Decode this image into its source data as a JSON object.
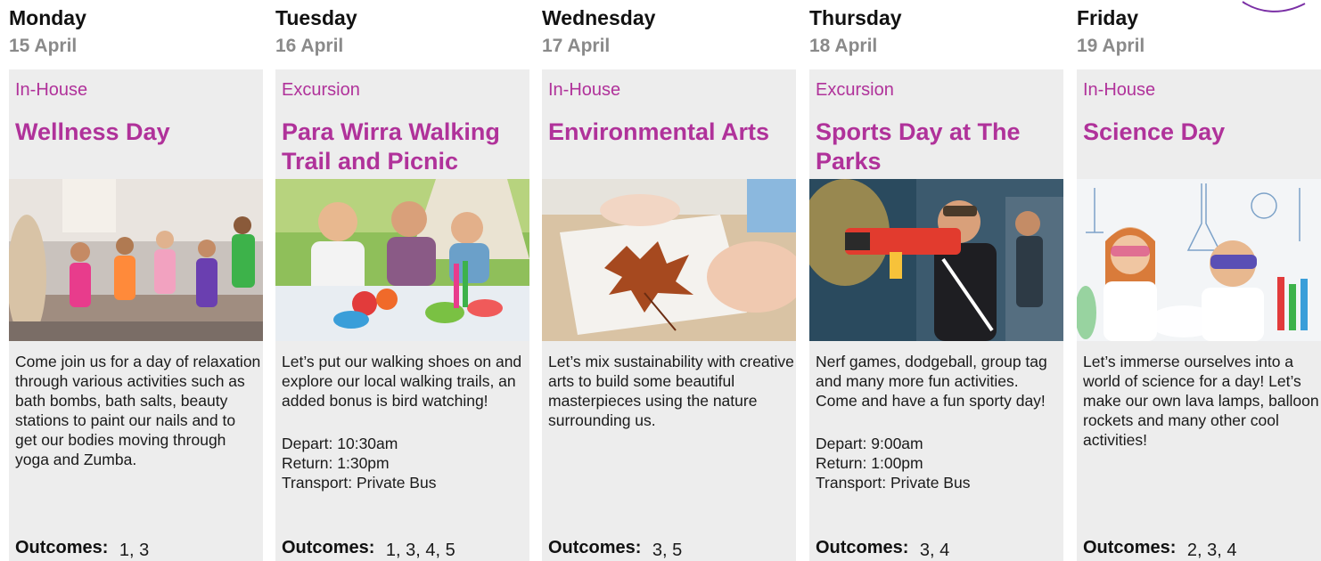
{
  "days": [
    {
      "day": "Monday",
      "date": "15 April",
      "type": "In-House",
      "title": "Wellness Day",
      "image_icon": "wellness-dance-photo",
      "description": "Come join us for a day of relaxation through various activities such as bath bombs, bath salts, beauty stations to paint our nails and to get our bodies moving through yoga and Zumba.",
      "depart": "",
      "return": "",
      "transport": "",
      "outcomes_label": "Outcomes:",
      "outcomes": "1, 3"
    },
    {
      "day": "Tuesday",
      "date": "16 April",
      "type": "Excursion",
      "title": "Para Wirra Walking Trail and Picnic",
      "image_icon": "picnic-photo",
      "description": "Let’s put our walking shoes on and explore our local walking trails, an added bonus is bird watching!",
      "depart": "Depart: 10:30am",
      "return": "Return: 1:30pm",
      "transport": "Transport: Private Bus",
      "outcomes_label": "Outcomes:",
      "outcomes": "1, 3, 4, 5"
    },
    {
      "day": "Wednesday",
      "date": "17 April",
      "type": "In-House",
      "title": "Environmental Arts",
      "image_icon": "leaf-art-photo",
      "description": "Let’s mix sustainability with creative arts to build some beautiful masterpieces using the nature surrounding us.",
      "depart": "",
      "return": "",
      "transport": "",
      "outcomes_label": "Outcomes:",
      "outcomes": "3, 5"
    },
    {
      "day": "Thursday",
      "date": "18 April",
      "type": "Excursion",
      "title": "Sports Day at The Parks",
      "image_icon": "nerf-game-photo",
      "description": "Nerf games, dodgeball, group tag and many more fun activities. Come and have a fun sporty day!",
      "depart": "Depart: 9:00am",
      "return": "Return: 1:00pm",
      "transport": "Transport: Private Bus",
      "outcomes_label": "Outcomes:",
      "outcomes": "3, 4"
    },
    {
      "day": "Friday",
      "date": "19 April",
      "type": "In-House",
      "title": "Science Day",
      "image_icon": "science-lab-photo",
      "description": "Let’s immerse ourselves into a world of science for a day! Let’s make our own lava lamps, balloon rockets and many other cool activities!",
      "depart": "",
      "return": "",
      "transport": "",
      "outcomes_label": "Outcomes:",
      "outcomes": "2, 3, 4"
    }
  ],
  "colors": {
    "accent": "#b0329a",
    "card_bg": "#ededed",
    "date_grey": "#8a8a8a"
  }
}
